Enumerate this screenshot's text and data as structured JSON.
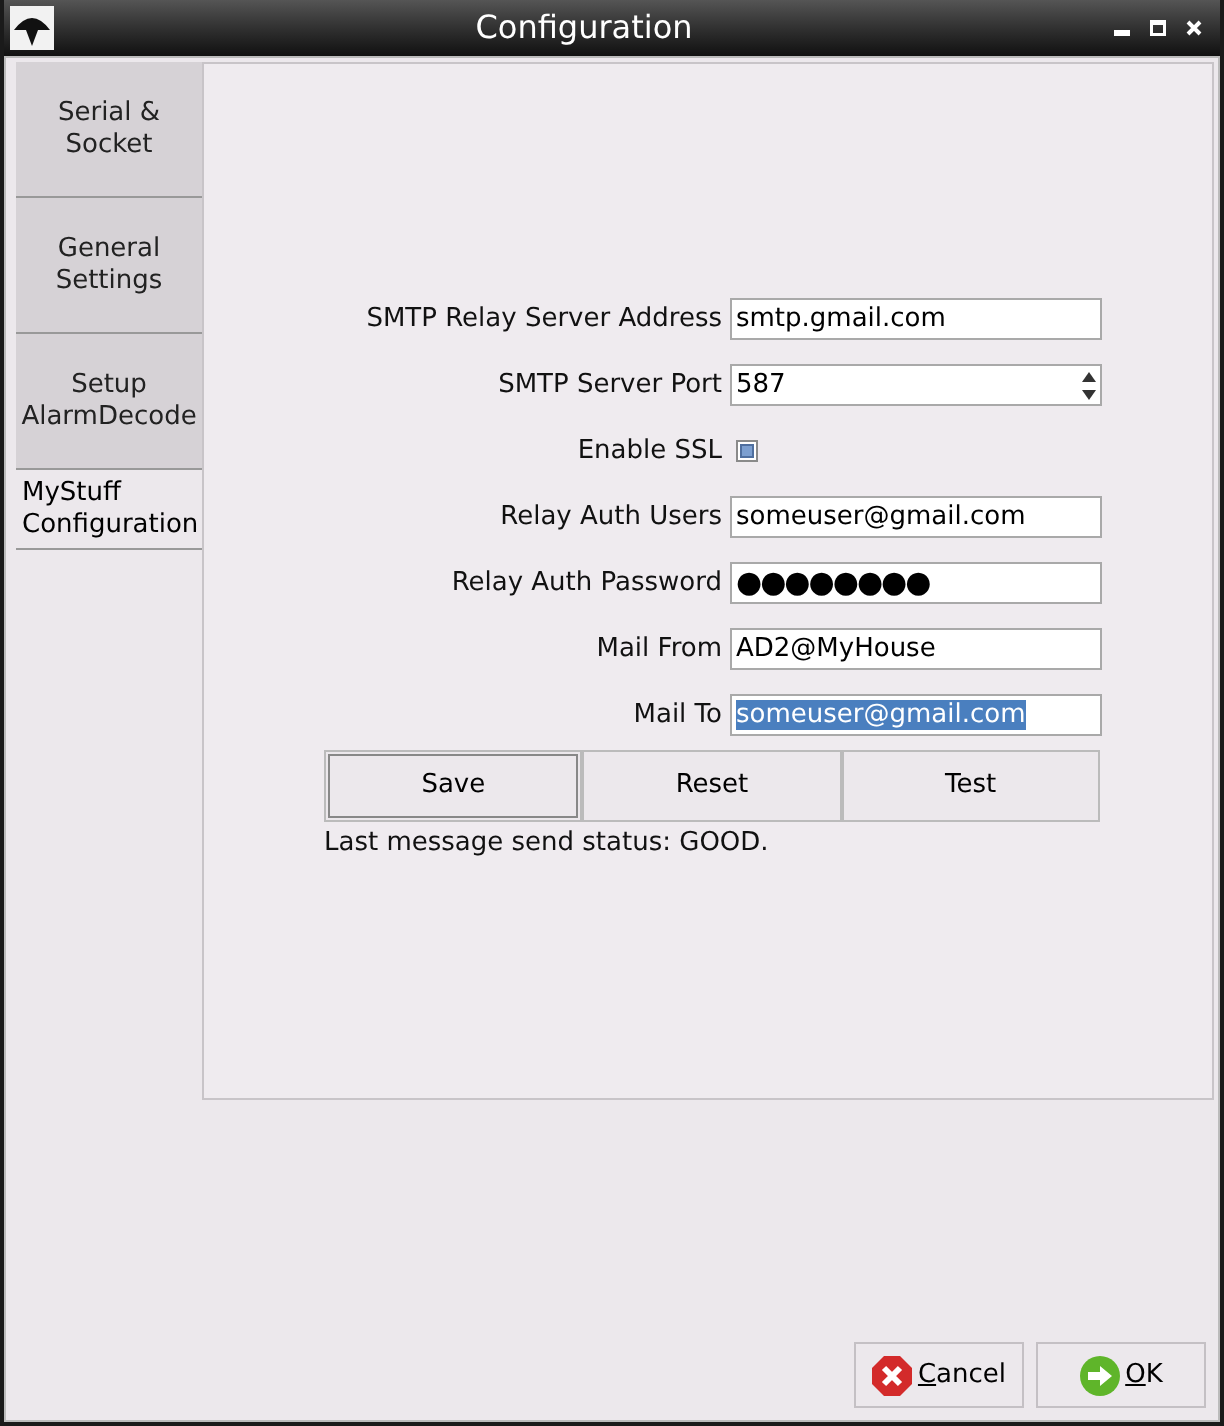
{
  "window": {
    "title": "Configuration"
  },
  "tabs": [
    {
      "label": "Serial & Socket",
      "selected": false
    },
    {
      "label": "General Settings",
      "selected": false
    },
    {
      "label": "Setup AlarmDecode",
      "selected": false
    },
    {
      "label": "MyStuff Configuration",
      "selected": true
    }
  ],
  "form": {
    "fields": [
      {
        "kind": "text",
        "label": "SMTP Relay Server Address",
        "value": "smtp.gmail.com",
        "selected": false
      },
      {
        "kind": "spin",
        "label": "SMTP Server Port",
        "value": "587",
        "selected": false
      },
      {
        "kind": "checkbox",
        "label": "Enable SSL",
        "checked": true
      },
      {
        "kind": "text",
        "label": "Relay Auth Users",
        "value": "someuser@gmail.com",
        "selected": false
      },
      {
        "kind": "password",
        "label": "Relay Auth Password",
        "value": "●●●●●●●●",
        "selected": false
      },
      {
        "kind": "text",
        "label": "Mail From",
        "value": "AD2@MyHouse",
        "selected": false
      },
      {
        "kind": "text",
        "label": "Mail To",
        "value": "someuser@gmail.com",
        "selected": true
      }
    ],
    "buttons": [
      {
        "label": "Save",
        "focused": true
      },
      {
        "label": "Reset",
        "focused": false
      },
      {
        "label": "Test",
        "focused": false
      }
    ],
    "status": "Last message send status: GOOD."
  },
  "dialog_buttons": [
    {
      "kind": "cancel",
      "label": "Cancel"
    },
    {
      "kind": "ok",
      "label": "OK"
    }
  ]
}
